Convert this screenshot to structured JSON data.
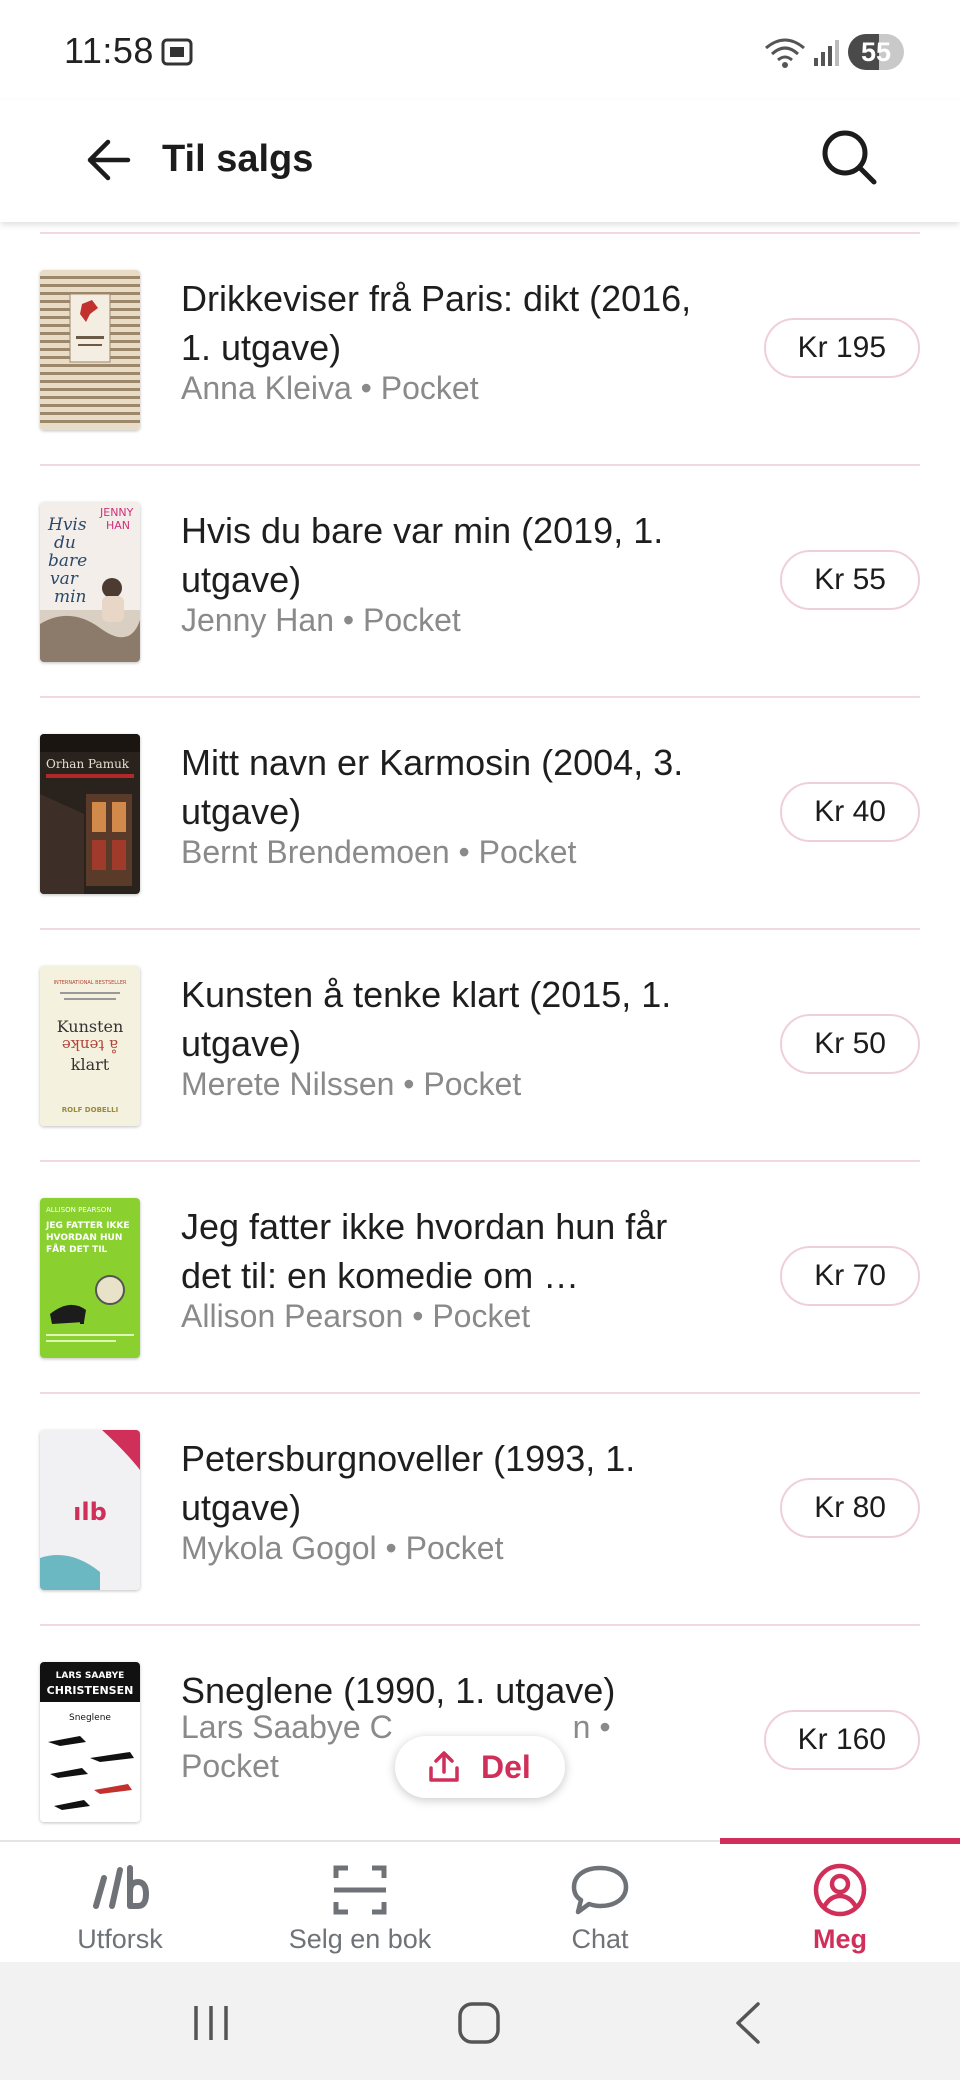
{
  "status_bar": {
    "time": "11:58",
    "battery": "55",
    "battery_level": 0.55
  },
  "header": {
    "title": "Til salgs"
  },
  "books": [
    {
      "title": "Drikkeviser frå Paris: dikt (2016, 1. utgave)",
      "author": "Anna Kleiva",
      "format": "Pocket",
      "price": "Kr 195"
    },
    {
      "title": "Hvis du bare var min (2019, 1. utgave)",
      "author": "Jenny Han",
      "format": "Pocket",
      "price": "Kr 55"
    },
    {
      "title": "Mitt navn er Karmosin (2004, 3. utgave)",
      "author": "Bernt Brendemoen",
      "format": "Pocket",
      "price": "Kr 40"
    },
    {
      "title": "Kunsten å tenke klart (2015, 1. utgave)",
      "author": "Merete Nilssen",
      "format": "Pocket",
      "price": "Kr 50"
    },
    {
      "title": "Jeg fatter ikke hvordan hun får det til: en komedie om …",
      "author": "Allison Pearson",
      "format": "Pocket",
      "price": "Kr 70"
    },
    {
      "title": "Petersburgnoveller (1993, 1. utgave)",
      "author": "Mykola Gogol",
      "format": "Pocket",
      "price": "Kr 80"
    },
    {
      "title": "Sneglene (1990, 1. utgave)",
      "author": "Lars Saabye C",
      "author_tail": "n •",
      "format": "Pocket",
      "price": "Kr 160"
    }
  ],
  "covers": {
    "hvis": {
      "line1": "Hvis",
      "line2": "du",
      "line3": "bare",
      "line4": "var",
      "line5": "min",
      "author1": "JENNY",
      "author2": "HAN"
    },
    "karmosin": {
      "author": "Orhan Pamuk"
    },
    "kunsten": {
      "line1": "Kunsten",
      "line2": "å tenke",
      "line3": "klart",
      "top": "INTERNATIONAL BESTSELLER",
      "author": "ROLF DOBELLI"
    },
    "jeg": {
      "author": "ALLISON PEARSON",
      "l1": "JEG FATTER IKKE",
      "l2": "HVORDAN HUN",
      "l3": "FÅR DET TIL"
    },
    "placeholder": {
      "logo": "ılb"
    },
    "sneglene": {
      "a1": "LARS SAABYE",
      "a2": "CHRISTENSEN",
      "title": "Sneglene"
    }
  },
  "share": {
    "label": "Del"
  },
  "bottom_nav": {
    "items": [
      {
        "label": "Utforsk",
        "icon": "logo-icon"
      },
      {
        "label": "Selg en bok",
        "icon": "scan-icon"
      },
      {
        "label": "Chat",
        "icon": "chat-bubble-icon"
      },
      {
        "label": "Meg",
        "icon": "profile-icon",
        "active": true
      }
    ]
  },
  "colors": {
    "accent": "#d02f5a",
    "divider": "#f2d9df",
    "muted_text": "#8a8a8a"
  }
}
